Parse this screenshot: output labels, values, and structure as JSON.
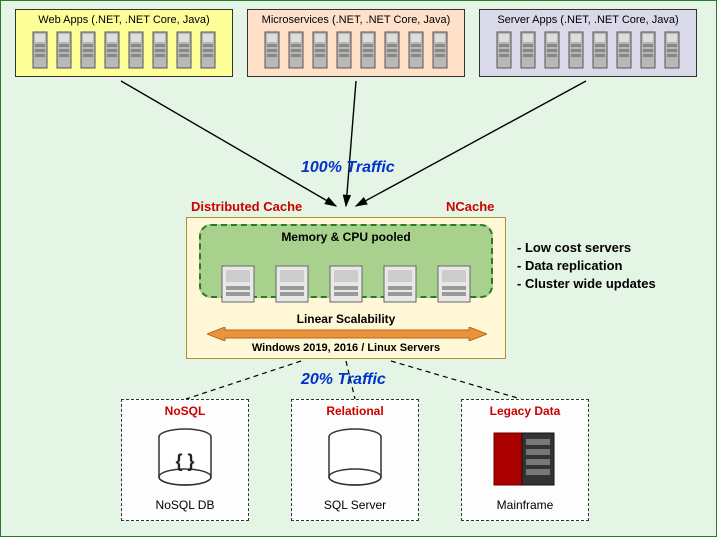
{
  "tiers": {
    "web": "Web Apps (.NET, .NET Core, Java)",
    "micro": "Microservices (.NET, .NET Core, Java)",
    "server": "Server Apps (.NET, .NET Core, Java)"
  },
  "traffic_top": "100% Traffic",
  "traffic_bottom": "20% Traffic",
  "redlabels": {
    "distributed_cache": "Distributed Cache",
    "ncache": "NCache"
  },
  "cache": {
    "memory_cpu": "Memory & CPU pooled",
    "linear_scalability": "Linear Scalability",
    "os": "Windows 2019, 2016 /   Linux Servers"
  },
  "bullets": [
    "- Low cost servers",
    "- Data replication",
    "- Cluster wide updates"
  ],
  "db": {
    "nosql": {
      "title": "NoSQL",
      "footer": "NoSQL DB",
      "symbol": "{ }"
    },
    "relational": {
      "title": "Relational",
      "footer": "SQL Server"
    },
    "legacy": {
      "title": "Legacy Data",
      "footer": "Mainframe"
    }
  }
}
